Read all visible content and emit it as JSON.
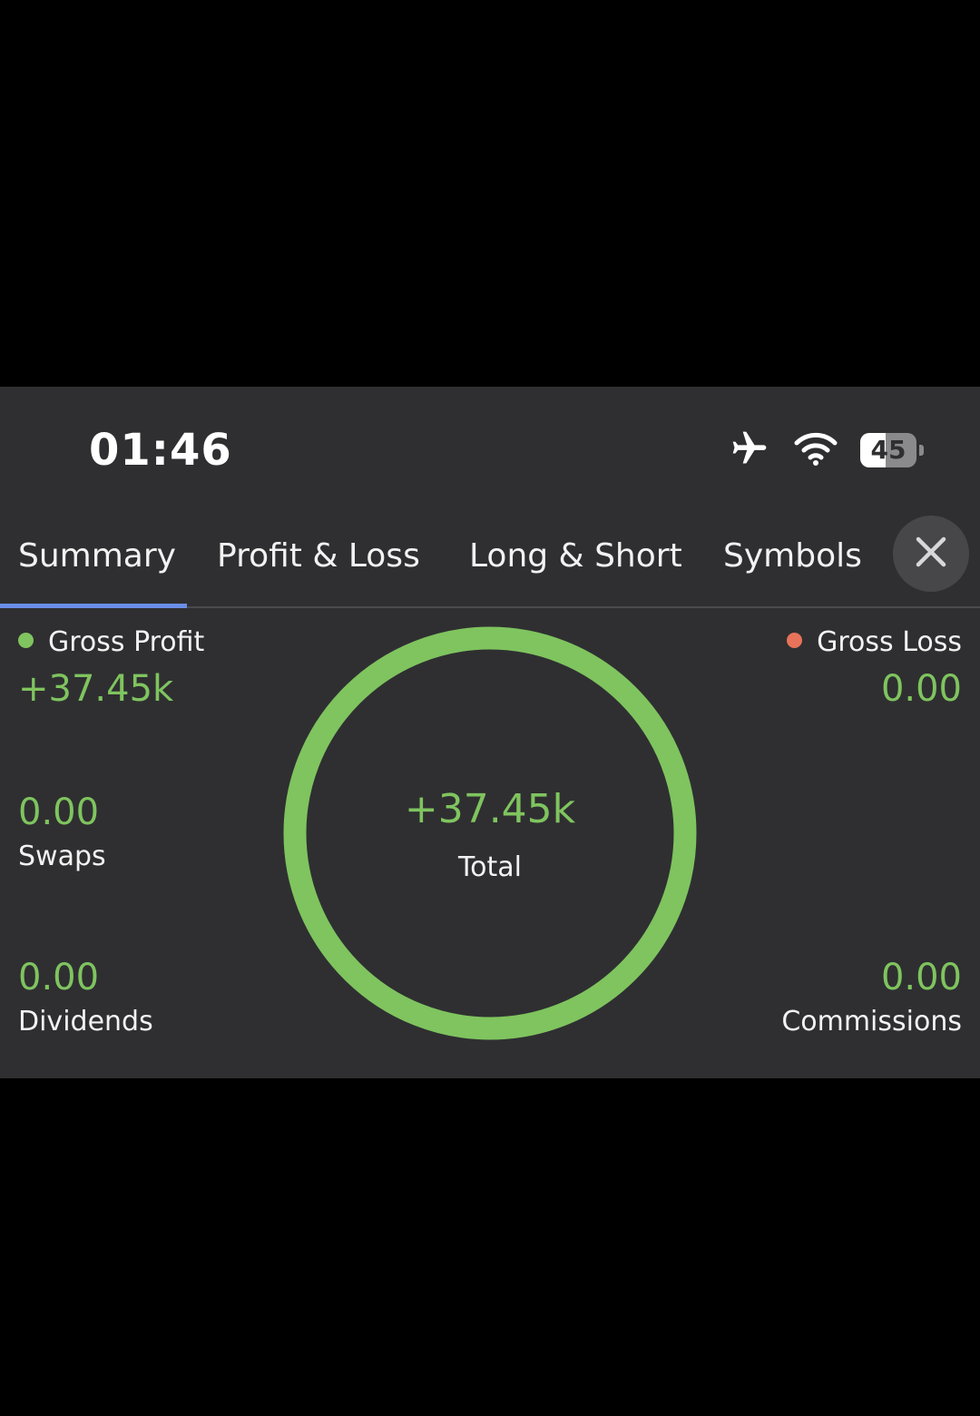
{
  "status_bar": {
    "time": "01:46",
    "battery_level": "45",
    "battery_fraction": 0.45,
    "icons": [
      "airplane-icon",
      "wifi-icon",
      "battery-icon"
    ]
  },
  "tabs": [
    {
      "label": "Summary",
      "active": true
    },
    {
      "label": "Profit & Loss",
      "active": false
    },
    {
      "label": "Long & Short",
      "active": false
    },
    {
      "label": "Symbols",
      "active": false
    }
  ],
  "summary": {
    "gross_profit": {
      "label": "Gross Profit",
      "value": "+37.45k",
      "dot_color": "#7fc45f"
    },
    "gross_loss": {
      "label": "Gross Loss",
      "value": "0.00",
      "dot_color": "#e8735a"
    },
    "swaps": {
      "label": "Swaps",
      "value": "0.00"
    },
    "dividends": {
      "label": "Dividends",
      "value": "0.00"
    },
    "commissions": {
      "label": "Commissions",
      "value": "0.00"
    },
    "total": {
      "label": "Total",
      "value": "+37.45k"
    }
  },
  "colors": {
    "positive": "#7fc45f",
    "negative": "#e8735a",
    "accent": "#6a8ee8",
    "background": "#2f2f31"
  }
}
